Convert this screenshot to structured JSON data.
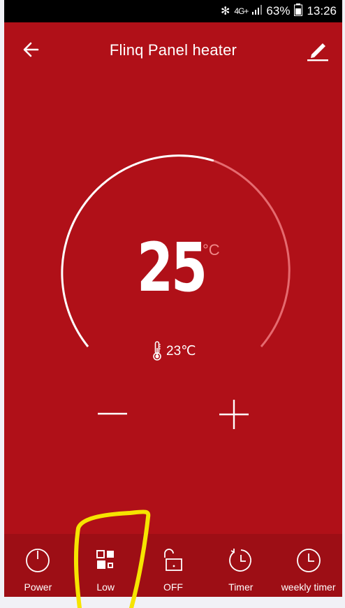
{
  "status": {
    "bluetooth": "✻",
    "network": "4G+",
    "battery": "63%",
    "time": "13:26"
  },
  "header": {
    "title": "Flinq Panel heater"
  },
  "thermostat": {
    "target": "25",
    "target_unit": "°C",
    "current": "23℃"
  },
  "bottom": {
    "items": [
      {
        "label": "Power",
        "icon": "power-icon"
      },
      {
        "label": "Low",
        "icon": "mode-grid-icon"
      },
      {
        "label": "OFF",
        "icon": "lock-open-icon"
      },
      {
        "label": "Timer",
        "icon": "timer-icon"
      },
      {
        "label": "weekly timer",
        "icon": "clock-icon"
      }
    ]
  },
  "colors": {
    "background": "#b01018",
    "bottom_bar": "#9d0e15",
    "accent_highlight": "#f6e400"
  }
}
